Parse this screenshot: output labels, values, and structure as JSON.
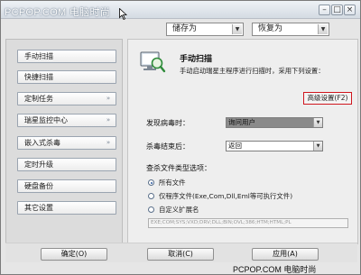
{
  "title": {
    "text": "PCPOP.COM 电脑时尚",
    "minimize": "–",
    "maximize": "□",
    "close": "×"
  },
  "toolbar": {
    "save_as": "储存为",
    "restore_as": "恢复为",
    "arrow": "▼"
  },
  "sidebar": {
    "items": [
      {
        "label": "手动扫描",
        "chevron": ""
      },
      {
        "label": "快捷扫描",
        "chevron": ""
      },
      {
        "label": "定制任务",
        "chevron": "»"
      },
      {
        "label": "瑞星监控中心",
        "chevron": "»"
      },
      {
        "label": "嵌入式杀毒",
        "chevron": "»"
      },
      {
        "label": "定时升级",
        "chevron": ""
      },
      {
        "label": "硬盘备份",
        "chevron": ""
      },
      {
        "label": "其它设置",
        "chevron": ""
      }
    ]
  },
  "panel": {
    "title": "手动扫描",
    "description": "手动启动瑞星主程序进行扫描时，采用下列设置：",
    "advanced_button": "高级设置(F2)",
    "on_virus_label": "发现病毒时：",
    "on_virus_value": "询问用户",
    "after_scan_label": "杀毒结束后：",
    "after_scan_value": "返回",
    "file_type_label": "查杀文件类型选项：",
    "radio_all": "所有文件",
    "radio_programs": "仅程序文件(Exe,Com,Dll,Eml等可执行文件)",
    "radio_custom": "自定义扩展名",
    "extensions": "EXE;COM;SYS;VXD;DRV;DLL;BIN;OVL;386;HTM;HTML;PL",
    "select_arrow": "▼"
  },
  "buttons": {
    "ok": "确定(O)",
    "cancel": "取消(C)",
    "apply": "应用(A)"
  },
  "watermark": "PCPOP.COM 电脑时尚",
  "colors": {
    "highlight_border": "#d0161e",
    "selected_value_bg": "#8a8a8a"
  }
}
